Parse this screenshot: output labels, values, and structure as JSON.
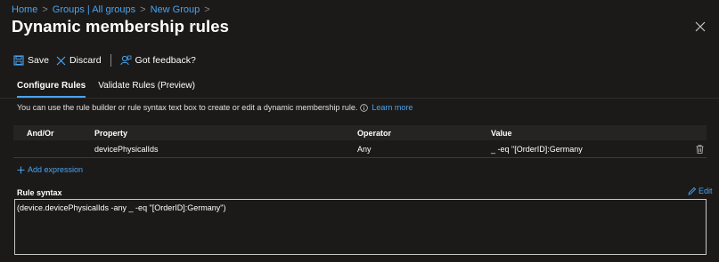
{
  "breadcrumb": [
    "Home",
    "Groups | All groups",
    "New Group"
  ],
  "page": {
    "title": "Dynamic membership rules",
    "more": "···"
  },
  "toolbar": {
    "save_label": "Save",
    "discard_label": "Discard",
    "feedback_label": "Got feedback?"
  },
  "tabs": [
    {
      "label": "Configure Rules",
      "active": true
    },
    {
      "label": "Validate Rules (Preview)",
      "active": false
    }
  ],
  "description": {
    "text": "You can use the rule builder or rule syntax text box to create or edit a dynamic membership rule.",
    "link": "Learn more"
  },
  "rules_table": {
    "headers": [
      "And/Or",
      "Property",
      "Operator",
      "Value"
    ],
    "rows": [
      {
        "and_or": "",
        "property": "devicePhysicalIds",
        "operator": "Any",
        "value": "_ -eq \"[OrderID]:Germany"
      }
    ]
  },
  "add_expression_label": "Add expression",
  "rule_syntax": {
    "label": "Rule syntax",
    "edit_label": "Edit",
    "text": "(device.devicePhysicalIds -any _ -eq \"[OrderID]:Germany\")"
  },
  "colors": {
    "background": "#1b1a19",
    "accent": "#4aa3f0",
    "header_row": "#252423",
    "text": "#ffffff"
  },
  "icons": [
    "chevron-right-icon",
    "close-icon",
    "save-icon",
    "discard-icon",
    "feedback-icon",
    "info-icon",
    "plus-icon",
    "trash-icon",
    "pencil-icon"
  ]
}
